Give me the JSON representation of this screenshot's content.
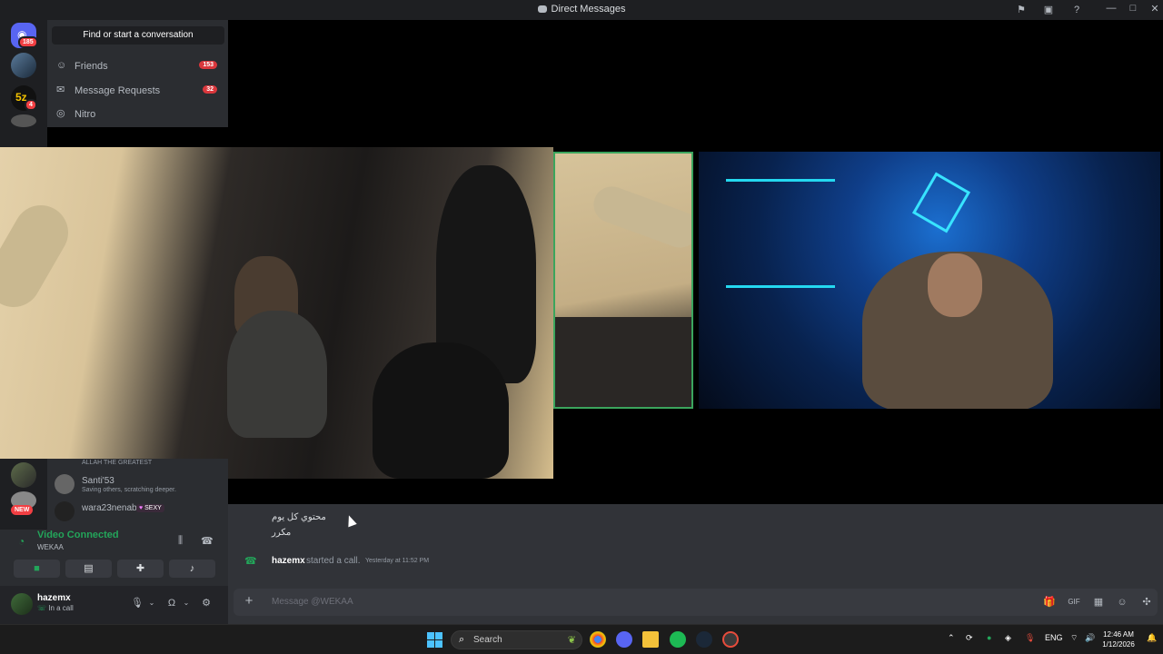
{
  "window": {
    "title": "Direct Messages"
  },
  "guilds": {
    "home_badge": "185",
    "guild3_badge": "4",
    "new_label": "NEW"
  },
  "dm_panel": {
    "find_button": "Find or start a conversation",
    "nav": [
      {
        "label": "Friends",
        "count": "153",
        "icon": "friends-icon"
      },
      {
        "label": "Message Requests",
        "count": "32",
        "icon": "mail-icon"
      },
      {
        "label": "Nitro",
        "count": "",
        "icon": "nitro-icon"
      }
    ]
  },
  "dm_list": [
    {
      "name": "",
      "status": "ALLAH THE GREATEST"
    },
    {
      "name": "Santi'53",
      "status": "Saving others, scratching deeper."
    },
    {
      "name": "wara23nenab",
      "status": "",
      "tag": "SEXY"
    }
  ],
  "rtc": {
    "status": "Video Connected",
    "channel": "WEKAA"
  },
  "user": {
    "name": "hazemx",
    "status": "In a call"
  },
  "chat": {
    "messages": [
      "محتوي كل يوم",
      "مكرر"
    ],
    "call_event": {
      "user": "hazemx",
      "text": "started a call.",
      "timestamp": "Yesterday at 11:52 PM"
    },
    "composer_placeholder": "Message @WEKAA"
  },
  "taskbar": {
    "search_placeholder": "Search",
    "language": "ENG",
    "time": "12:46 AM",
    "date": "1/12/2026"
  },
  "colors": {
    "accent_green": "#23a55a",
    "badge_red": "#da373c",
    "discord_blurple": "#5865f2"
  }
}
